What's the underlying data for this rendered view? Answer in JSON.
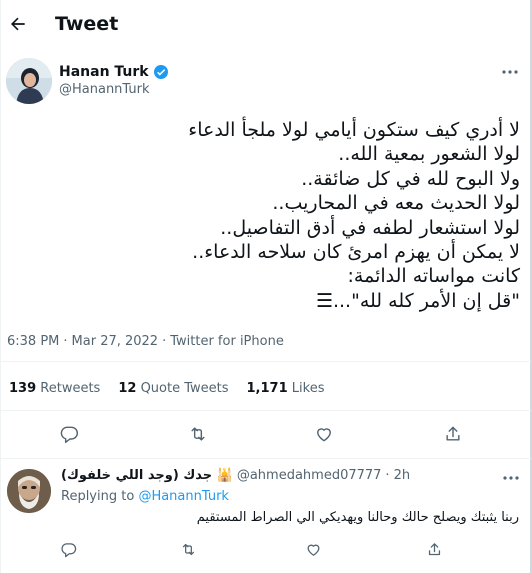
{
  "header": {
    "title": "Tweet",
    "back_icon": "arrow-left-icon"
  },
  "author": {
    "name": "Hanan Turk",
    "handle": "@HanannTurk",
    "verified_icon": "verified-badge-icon",
    "more_icon": "more-horizontal-icon"
  },
  "tweet": {
    "lines": [
      "لا أدري كيف ستكون أيامي لولا ملجأ الدعاء",
      "لولا الشعور بمعية الله..",
      "ولا البوح لله في كل ضائقة..",
      "لولا الحديث معه في المحاريب..",
      "لولا استشعار لطفه في أدق التفاصيل..",
      "لا يمكن أن يهزم امرئ كان سلاحه الدعاء..",
      "كانت مواساته الدائمة:",
      "\"قل إن الأمر كله لله\"...☰"
    ],
    "time": "6:38 PM",
    "separator": "·",
    "date": "Mar 27, 2022",
    "source": "Twitter for iPhone"
  },
  "stats": {
    "retweets_count": "139",
    "retweets_label": "Retweets",
    "quotes_count": "12",
    "quotes_label": "Quote Tweets",
    "likes_count": "1,171",
    "likes_label": "Likes"
  },
  "actions": [
    "reply-icon",
    "retweet-icon",
    "like-icon",
    "share-icon"
  ],
  "reply": {
    "name": "جدك (وجد اللي خلفوك) 🕌",
    "handle": "@ahmedahmed07777",
    "separator": "·",
    "time": "2h",
    "replying_label": "Replying to",
    "replying_to": "@HanannTurk",
    "text": "ربنا يثبتك ويصلح حالك وحالنا ويهديكي الي الصراط المستقيم"
  },
  "colors": {
    "text": "#0f1419",
    "secondary": "#536471",
    "accent": "#1d9bf0",
    "divider": "#eff3f4"
  }
}
